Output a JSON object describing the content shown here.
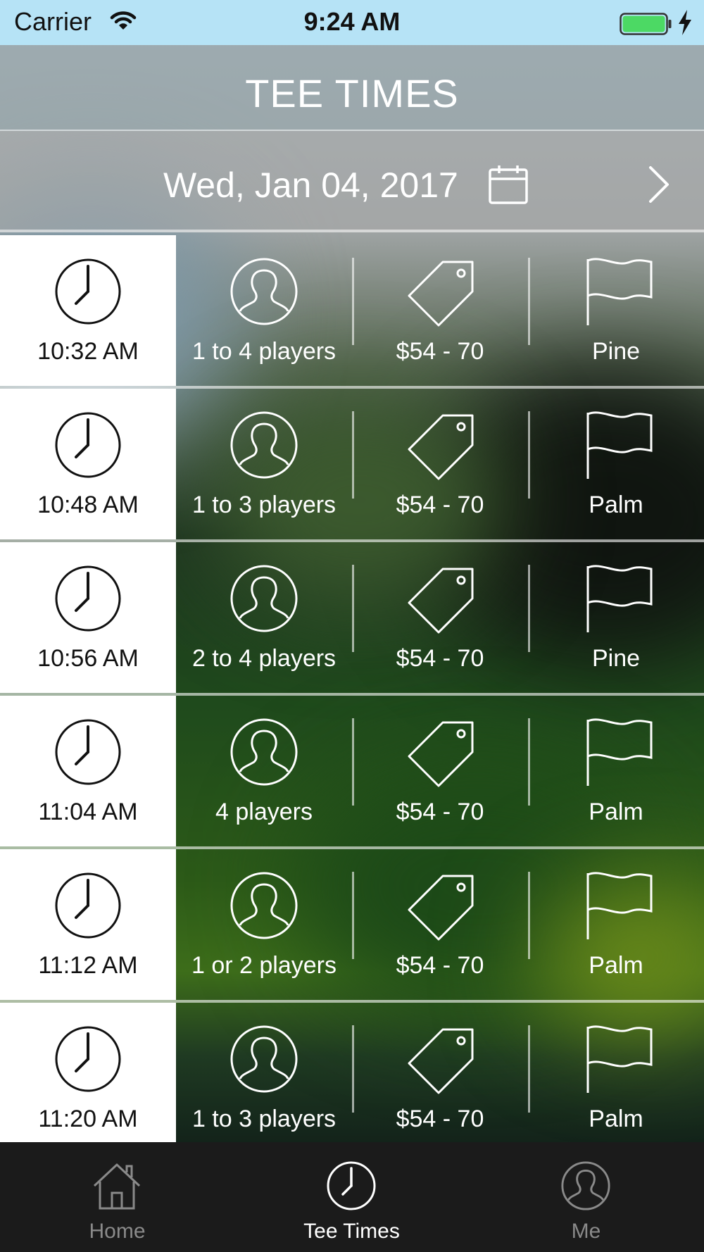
{
  "status_bar": {
    "carrier": "Carrier",
    "time": "9:24 AM",
    "battery_color": "#4cd964"
  },
  "header": {
    "title": "TEE TIMES"
  },
  "date_bar": {
    "date": "Wed, Jan 04, 2017",
    "calendar_icon": "calendar-icon",
    "next_icon": "chevron-right-icon"
  },
  "tee_times": [
    {
      "time": "10:32 AM",
      "players": "1 to 4 players",
      "price": "$54 - 70",
      "course": "Pine"
    },
    {
      "time": "10:48 AM",
      "players": "1 to 3 players",
      "price": "$54 - 70",
      "course": "Palm"
    },
    {
      "time": "10:56 AM",
      "players": "2 to 4 players",
      "price": "$54 - 70",
      "course": "Pine"
    },
    {
      "time": "11:04 AM",
      "players": "4 players",
      "price": "$54 - 70",
      "course": "Palm"
    },
    {
      "time": "11:12 AM",
      "players": "1 or 2 players",
      "price": "$54 - 70",
      "course": "Palm"
    },
    {
      "time": "11:20 AM",
      "players": "1 to 3 players",
      "price": "$54 - 70",
      "course": "Palm"
    }
  ],
  "tab_bar": {
    "items": [
      {
        "label": "Home",
        "icon": "home-icon",
        "selected": false
      },
      {
        "label": "Tee Times",
        "icon": "clock-icon",
        "selected": true
      },
      {
        "label": "Me",
        "icon": "user-icon",
        "selected": false
      }
    ],
    "active_color": "#ffffff",
    "inactive_color": "#8a8a8a"
  }
}
